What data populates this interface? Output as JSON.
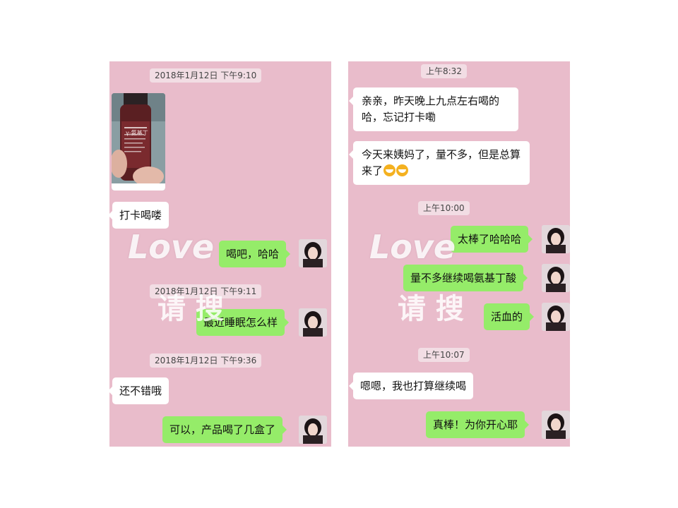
{
  "left_panel": {
    "timestamps": [
      "2018年1月12日 下午9:10",
      "2018年1月12日 下午9:11",
      "2018年1月12日 下午9:36"
    ],
    "messages": [
      {
        "side": "recv",
        "text": "打卡喝喽"
      },
      {
        "side": "sent",
        "text": "喝吧，哈哈"
      },
      {
        "side": "sent",
        "text": "最近睡眠怎么样"
      },
      {
        "side": "recv",
        "text": "还不错哦"
      },
      {
        "side": "sent",
        "text": "可以，产品喝了几盒了"
      }
    ],
    "photo_label": "γ-氨基丁"
  },
  "right_panel": {
    "timestamps": [
      "上午8:32",
      "上午10:00",
      "上午10:07"
    ],
    "messages": [
      {
        "side": "recv",
        "text": "亲亲，昨天晚上九点左右喝的哈，忘记打卡嘞"
      },
      {
        "side": "recv",
        "text": "今天来姨妈了，量不多，但是总算来了"
      },
      {
        "side": "sent",
        "text": "太棒了哈哈哈"
      },
      {
        "side": "sent",
        "text": "量不多继续喝氨基丁酸"
      },
      {
        "side": "sent",
        "text": "活血的"
      },
      {
        "side": "recv",
        "text": "嗯嗯，我也打算继续喝"
      },
      {
        "side": "sent",
        "text": "真棒！为你开心耶"
      }
    ]
  },
  "watermark": {
    "line1": "Love",
    "line2": "请 搜"
  },
  "colors": {
    "panel_bg": "#e9bccb",
    "sent_bubble": "#95ec69",
    "recv_bubble": "#ffffff",
    "timestamp_bg": "#f2dde4"
  }
}
